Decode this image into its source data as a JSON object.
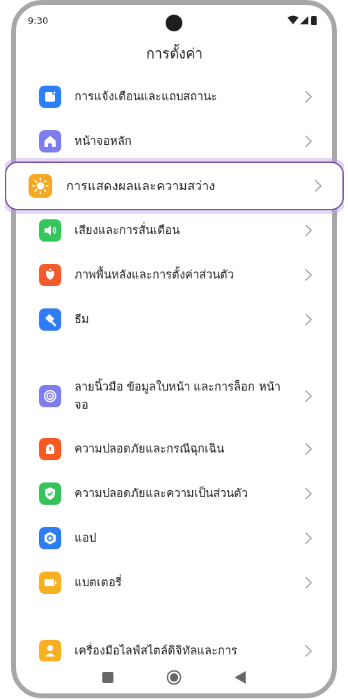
{
  "status_bar": {
    "time": "9:30"
  },
  "title": "การตั้งค่า",
  "groups": [
    {
      "items": [
        {
          "label": "การแจ้งเตือนและแถบสถานะ",
          "color": "#2f80f7",
          "selected": false
        },
        {
          "label": "หน้าจอหลัก",
          "color": "#7c7ef0",
          "selected": false
        },
        {
          "label": "การแสดงผลและความสว่าง",
          "color": "#f7a823",
          "selected": true
        },
        {
          "label": "เสียงและการสั่นเตือน",
          "color": "#34c65a",
          "selected": false
        },
        {
          "label": "ภาพพื้นหลังและการตั้งค่าส่วนตัว",
          "color": "#f55a2c",
          "selected": false
        },
        {
          "label": "ธีม",
          "color": "#2f7cf6",
          "selected": false
        }
      ]
    },
    {
      "items": [
        {
          "label": "ลายนิ้วมือ ข้อมูลใบหน้า และการล็อก หน้าจอ",
          "color": "#7d7df0",
          "selected": false
        },
        {
          "label": "ความปลอดภัยและกรณีฉุกเฉิน",
          "color": "#f45a22",
          "selected": false
        },
        {
          "label": "ความปลอดภัยและความเป็นส่วนตัว",
          "color": "#35c25a",
          "selected": false
        },
        {
          "label": "แอป",
          "color": "#2f7bf0",
          "selected": false
        },
        {
          "label": "แบตเตอรี่",
          "color": "#f8b023",
          "selected": false
        }
      ]
    },
    {
      "items": [
        {
          "label": "เครื่องมือไลฟ์สไตล์ดิจิทัลและการ",
          "color": "#f8b023",
          "selected": false
        }
      ]
    }
  ]
}
